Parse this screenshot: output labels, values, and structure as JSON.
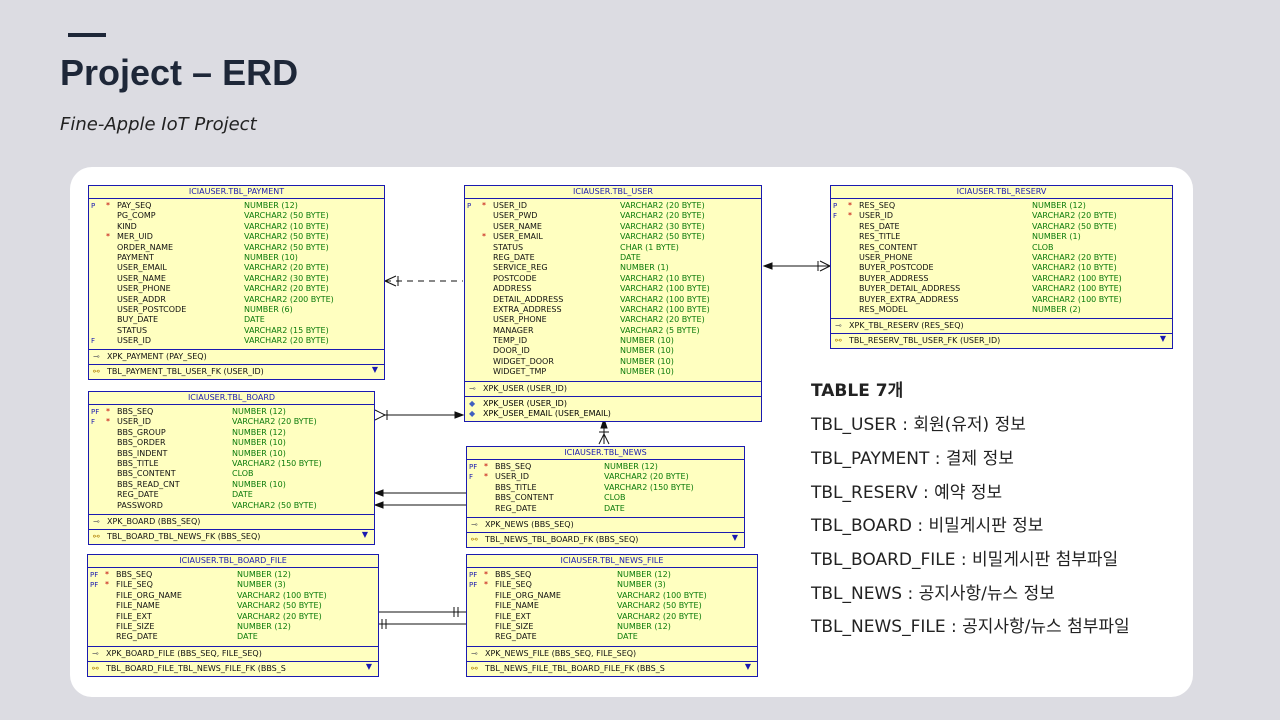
{
  "header": {
    "title": "Project – ERD",
    "subtitle": "Fine-Apple IoT Project"
  },
  "tables": {
    "payment": {
      "name": "ICIAUSER.TBL_PAYMENT",
      "columns": [
        {
          "mark": "P",
          "star": "*",
          "name": "PAY_SEQ",
          "type": "NUMBER (12)"
        },
        {
          "mark": "",
          "star": "",
          "name": "PG_COMP",
          "type": "VARCHAR2 (50 BYTE)"
        },
        {
          "mark": "",
          "star": "",
          "name": "KIND",
          "type": "VARCHAR2 (10 BYTE)"
        },
        {
          "mark": "",
          "star": "*",
          "name": "MER_UID",
          "type": "VARCHAR2 (50 BYTE)"
        },
        {
          "mark": "",
          "star": "",
          "name": "ORDER_NAME",
          "type": "VARCHAR2 (50 BYTE)"
        },
        {
          "mark": "",
          "star": "",
          "name": "PAYMENT",
          "type": "NUMBER (10)"
        },
        {
          "mark": "",
          "star": "",
          "name": "USER_EMAIL",
          "type": "VARCHAR2 (20 BYTE)"
        },
        {
          "mark": "",
          "star": "",
          "name": "USER_NAME",
          "type": "VARCHAR2 (30 BYTE)"
        },
        {
          "mark": "",
          "star": "",
          "name": "USER_PHONE",
          "type": "VARCHAR2 (20 BYTE)"
        },
        {
          "mark": "",
          "star": "",
          "name": "USER_ADDR",
          "type": "VARCHAR2 (200 BYTE)"
        },
        {
          "mark": "",
          "star": "",
          "name": "USER_POSTCODE",
          "type": "NUMBER (6)"
        },
        {
          "mark": "",
          "star": "",
          "name": "BUY_DATE",
          "type": "DATE"
        },
        {
          "mark": "",
          "star": "",
          "name": "STATUS",
          "type": "VARCHAR2 (15 BYTE)"
        },
        {
          "mark": "F",
          "star": "",
          "name": "USER_ID",
          "type": "VARCHAR2 (20 BYTE)"
        }
      ],
      "pk": "XPK_PAYMENT (PAY_SEQ)",
      "fk": "TBL_PAYMENT_TBL_USER_FK (USER_ID)"
    },
    "user": {
      "name": "ICIAUSER.TBL_USER",
      "columns": [
        {
          "mark": "P",
          "star": "*",
          "name": "USER_ID",
          "type": "VARCHAR2 (20 BYTE)"
        },
        {
          "mark": "",
          "star": "",
          "name": "USER_PWD",
          "type": "VARCHAR2 (20 BYTE)"
        },
        {
          "mark": "",
          "star": "",
          "name": "USER_NAME",
          "type": "VARCHAR2 (30 BYTE)"
        },
        {
          "mark": "",
          "star": "*",
          "name": "USER_EMAIL",
          "type": "VARCHAR2 (50 BYTE)"
        },
        {
          "mark": "",
          "star": "",
          "name": "STATUS",
          "type": "CHAR (1 BYTE)"
        },
        {
          "mark": "",
          "star": "",
          "name": "REG_DATE",
          "type": "DATE"
        },
        {
          "mark": "",
          "star": "",
          "name": "SERVICE_REG",
          "type": "NUMBER (1)"
        },
        {
          "mark": "",
          "star": "",
          "name": "POSTCODE",
          "type": "VARCHAR2 (10 BYTE)"
        },
        {
          "mark": "",
          "star": "",
          "name": "ADDRESS",
          "type": "VARCHAR2 (100 BYTE)"
        },
        {
          "mark": "",
          "star": "",
          "name": "DETAIL_ADDRESS",
          "type": "VARCHAR2 (100 BYTE)"
        },
        {
          "mark": "",
          "star": "",
          "name": "EXTRA_ADDRESS",
          "type": "VARCHAR2 (100 BYTE)"
        },
        {
          "mark": "",
          "star": "",
          "name": "USER_PHONE",
          "type": "VARCHAR2 (20 BYTE)"
        },
        {
          "mark": "",
          "star": "",
          "name": "MANAGER",
          "type": "VARCHAR2 (5 BYTE)"
        },
        {
          "mark": "",
          "star": "",
          "name": "TEMP_ID",
          "type": "NUMBER (10)"
        },
        {
          "mark": "",
          "star": "",
          "name": "DOOR_ID",
          "type": "NUMBER (10)"
        },
        {
          "mark": "",
          "star": "",
          "name": "WIDGET_DOOR",
          "type": "NUMBER (10)"
        },
        {
          "mark": "",
          "star": "",
          "name": "WIDGET_TMP",
          "type": "NUMBER (10)"
        }
      ],
      "pk": "XPK_USER (USER_ID)",
      "idx": [
        "XPK_USER (USER_ID)",
        "XPK_USER_EMAIL (USER_EMAIL)"
      ]
    },
    "reserv": {
      "name": "ICIAUSER.TBL_RESERV",
      "columns": [
        {
          "mark": "P",
          "star": "*",
          "name": "RES_SEQ",
          "type": "NUMBER (12)"
        },
        {
          "mark": "F",
          "star": "*",
          "name": "USER_ID",
          "type": "VARCHAR2 (20 BYTE)"
        },
        {
          "mark": "",
          "star": "",
          "name": "RES_DATE",
          "type": "VARCHAR2 (50 BYTE)"
        },
        {
          "mark": "",
          "star": "",
          "name": "RES_TITLE",
          "type": "NUMBER (1)"
        },
        {
          "mark": "",
          "star": "",
          "name": "RES_CONTENT",
          "type": "CLOB"
        },
        {
          "mark": "",
          "star": "",
          "name": "USER_PHONE",
          "type": "VARCHAR2 (20 BYTE)"
        },
        {
          "mark": "",
          "star": "",
          "name": "BUYER_POSTCODE",
          "type": "VARCHAR2 (10 BYTE)"
        },
        {
          "mark": "",
          "star": "",
          "name": "BUYER_ADDRESS",
          "type": "VARCHAR2 (100 BYTE)"
        },
        {
          "mark": "",
          "star": "",
          "name": "BUYER_DETAIL_ADDRESS",
          "type": "VARCHAR2 (100 BYTE)"
        },
        {
          "mark": "",
          "star": "",
          "name": "BUYER_EXTRA_ADDRESS",
          "type": "VARCHAR2 (100 BYTE)"
        },
        {
          "mark": "",
          "star": "",
          "name": "RES_MODEL",
          "type": "NUMBER (2)"
        }
      ],
      "pk": "XPK_TBL_RESERV (RES_SEQ)",
      "fk": "TBL_RESERV_TBL_USER_FK (USER_ID)"
    },
    "board": {
      "name": "ICIAUSER.TBL_BOARD",
      "columns": [
        {
          "mark": "PF",
          "star": "*",
          "name": "BBS_SEQ",
          "type": "NUMBER (12)"
        },
        {
          "mark": "F",
          "star": "*",
          "name": "USER_ID",
          "type": "VARCHAR2 (20 BYTE)"
        },
        {
          "mark": "",
          "star": "",
          "name": "BBS_GROUP",
          "type": "NUMBER (12)"
        },
        {
          "mark": "",
          "star": "",
          "name": "BBS_ORDER",
          "type": "NUMBER (10)"
        },
        {
          "mark": "",
          "star": "",
          "name": "BBS_INDENT",
          "type": "NUMBER (10)"
        },
        {
          "mark": "",
          "star": "",
          "name": "BBS_TITLE",
          "type": "VARCHAR2 (150 BYTE)"
        },
        {
          "mark": "",
          "star": "",
          "name": "BBS_CONTENT",
          "type": "CLOB"
        },
        {
          "mark": "",
          "star": "",
          "name": "BBS_READ_CNT",
          "type": "NUMBER (10)"
        },
        {
          "mark": "",
          "star": "",
          "name": "REG_DATE",
          "type": "DATE"
        },
        {
          "mark": "",
          "star": "",
          "name": "PASSWORD",
          "type": "VARCHAR2 (50 BYTE)"
        }
      ],
      "pk": "XPK_BOARD (BBS_SEQ)",
      "fk": "TBL_BOARD_TBL_NEWS_FK (BBS_SEQ)"
    },
    "news": {
      "name": "ICIAUSER.TBL_NEWS",
      "columns": [
        {
          "mark": "PF",
          "star": "*",
          "name": "BBS_SEQ",
          "type": "NUMBER (12)"
        },
        {
          "mark": "F",
          "star": "*",
          "name": "USER_ID",
          "type": "VARCHAR2 (20 BYTE)"
        },
        {
          "mark": "",
          "star": "",
          "name": "BBS_TITLE",
          "type": "VARCHAR2 (150 BYTE)"
        },
        {
          "mark": "",
          "star": "",
          "name": "BBS_CONTENT",
          "type": "CLOB"
        },
        {
          "mark": "",
          "star": "",
          "name": "REG_DATE",
          "type": "DATE"
        }
      ],
      "pk": "XPK_NEWS (BBS_SEQ)",
      "fk": "TBL_NEWS_TBL_BOARD_FK (BBS_SEQ)"
    },
    "board_file": {
      "name": "ICIAUSER.TBL_BOARD_FILE",
      "columns": [
        {
          "mark": "PF",
          "star": "*",
          "name": "BBS_SEQ",
          "type": "NUMBER (12)"
        },
        {
          "mark": "PF",
          "star": "*",
          "name": "FILE_SEQ",
          "type": "NUMBER (3)"
        },
        {
          "mark": "",
          "star": "",
          "name": "FILE_ORG_NAME",
          "type": "VARCHAR2 (100 BYTE)"
        },
        {
          "mark": "",
          "star": "",
          "name": "FILE_NAME",
          "type": "VARCHAR2 (50 BYTE)"
        },
        {
          "mark": "",
          "star": "",
          "name": "FILE_EXT",
          "type": "VARCHAR2 (20 BYTE)"
        },
        {
          "mark": "",
          "star": "",
          "name": "FILE_SIZE",
          "type": "NUMBER (12)"
        },
        {
          "mark": "",
          "star": "",
          "name": "REG_DATE",
          "type": "DATE"
        }
      ],
      "pk": "XPK_BOARD_FILE (BBS_SEQ, FILE_SEQ)",
      "fk": "TBL_BOARD_FILE_TBL_NEWS_FILE_FK (BBS_S"
    },
    "news_file": {
      "name": "ICIAUSER.TBL_NEWS_FILE",
      "columns": [
        {
          "mark": "PF",
          "star": "*",
          "name": "BBS_SEQ",
          "type": "NUMBER (12)"
        },
        {
          "mark": "PF",
          "star": "*",
          "name": "FILE_SEQ",
          "type": "NUMBER (3)"
        },
        {
          "mark": "",
          "star": "",
          "name": "FILE_ORG_NAME",
          "type": "VARCHAR2 (100 BYTE)"
        },
        {
          "mark": "",
          "star": "",
          "name": "FILE_NAME",
          "type": "VARCHAR2 (50 BYTE)"
        },
        {
          "mark": "",
          "star": "",
          "name": "FILE_EXT",
          "type": "VARCHAR2 (20 BYTE)"
        },
        {
          "mark": "",
          "star": "",
          "name": "FILE_SIZE",
          "type": "NUMBER (12)"
        },
        {
          "mark": "",
          "star": "",
          "name": "REG_DATE",
          "type": "DATE"
        }
      ],
      "pk": "XPK_NEWS_FILE (BBS_SEQ, FILE_SEQ)",
      "fk": "TBL_NEWS_FILE_TBL_BOARD_FILE_FK (BBS_S"
    }
  },
  "summary": {
    "heading": "TABLE  7개",
    "items": [
      "TBL_USER : 회원(유저) 정보",
      "TBL_PAYMENT : 결제 정보",
      "TBL_RESERV : 예약 정보",
      "TBL_BOARD : 비밀게시판 정보",
      "TBL_BOARD_FILE : 비밀게시판 첨부파일",
      "TBL_NEWS : 공지사항/뉴스 정보",
      "TBL_NEWS_FILE : 공지사항/뉴스 첨부파일"
    ]
  },
  "colors": {
    "table_fill": "#ffffc0",
    "table_border": "#1a1ab0",
    "type_text": "#0a7a0a",
    "card": "#ffffff",
    "background": "#dcdce2"
  }
}
